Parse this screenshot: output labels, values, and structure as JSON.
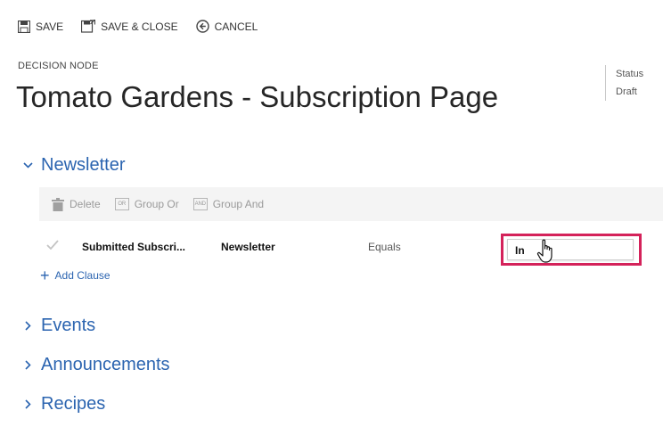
{
  "toolbar": {
    "save_label": "SAVE",
    "save_close_label": "SAVE & CLOSE",
    "cancel_label": "CANCEL"
  },
  "header": {
    "node_type": "DECISION NODE",
    "title": "Tomato Gardens - Subscription Page",
    "status_label": "Status",
    "status_value": "Draft"
  },
  "sections": {
    "newsletter": "Newsletter",
    "events": "Events",
    "announcements": "Announcements",
    "recipes": "Recipes"
  },
  "action_bar": {
    "delete_label": "Delete",
    "group_or_label": "Group Or",
    "group_and_label": "Group And",
    "or_icon_text": "OR",
    "and_icon_text": "AND"
  },
  "clause": {
    "field": "Submitted Subscri...",
    "attribute": "Newsletter",
    "operator": "Equals",
    "value": "In"
  },
  "add_clause_label": "Add Clause",
  "colors": {
    "accent": "#2b64b0",
    "highlight": "#d4225a"
  }
}
